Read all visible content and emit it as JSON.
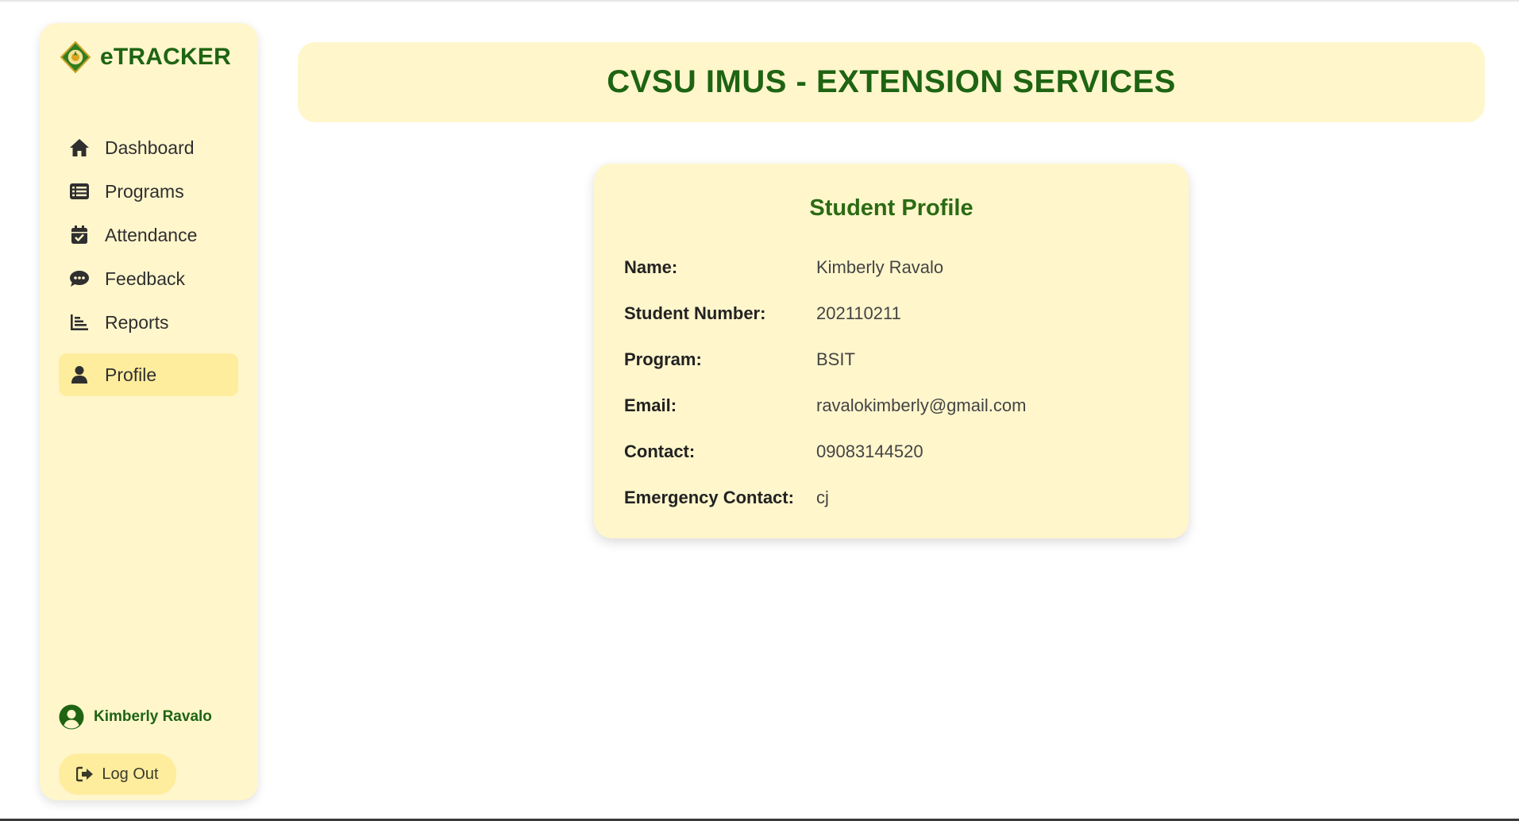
{
  "app": {
    "brand": "eTRACKER"
  },
  "sidebar": {
    "items": [
      {
        "label": "Dashboard",
        "icon": "home-icon"
      },
      {
        "label": "Programs",
        "icon": "list-icon"
      },
      {
        "label": "Attendance",
        "icon": "calendar-check-icon"
      },
      {
        "label": "Feedback",
        "icon": "comment-dots-icon"
      },
      {
        "label": "Reports",
        "icon": "bar-chart-icon"
      },
      {
        "label": "Profile",
        "icon": "user-icon",
        "active": true
      }
    ],
    "user_name": "Kimberly Ravalo",
    "logout_label": "Log Out"
  },
  "header": {
    "title": "CVSU IMUS - EXTENSION SERVICES"
  },
  "profile": {
    "title": "Student Profile",
    "fields": [
      {
        "label": "Name:",
        "value": "Kimberly Ravalo"
      },
      {
        "label": "Student Number:",
        "value": "202110211"
      },
      {
        "label": "Program:",
        "value": "BSIT"
      },
      {
        "label": "Email:",
        "value": "ravalokimberly@gmail.com"
      },
      {
        "label": "Contact:",
        "value": "09083144520"
      },
      {
        "label": "Emergency Contact:",
        "value": "cj"
      }
    ]
  },
  "colors": {
    "accent_green": "#1e6413",
    "panel_bg": "#fff6cc",
    "active_bg": "#ffed9e"
  }
}
